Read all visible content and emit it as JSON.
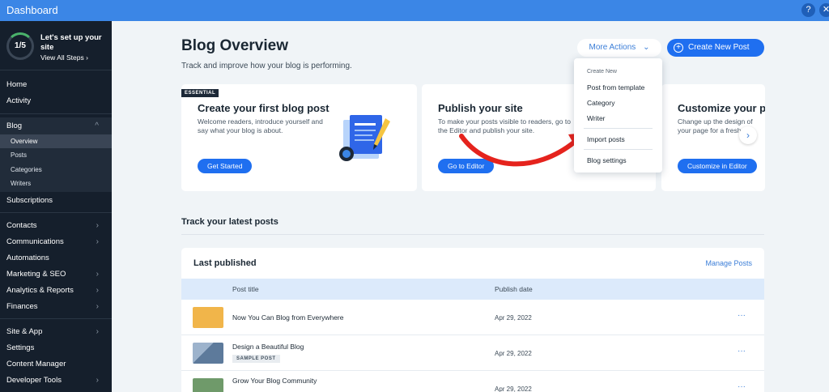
{
  "topbar": {
    "title": "Dashboard",
    "help_glyph": "?",
    "close_glyph": "✕"
  },
  "setup": {
    "progress": "1/5",
    "title": "Let's set up your site",
    "link": "View All Steps ›"
  },
  "sidebar": {
    "items": [
      {
        "label": "Home"
      },
      {
        "label": "Activity"
      },
      {
        "label": "Blog"
      },
      {
        "label": "Subscriptions"
      },
      {
        "label": "Contacts"
      },
      {
        "label": "Communications"
      },
      {
        "label": "Automations"
      },
      {
        "label": "Marketing & SEO"
      },
      {
        "label": "Analytics & Reports"
      },
      {
        "label": "Finances"
      },
      {
        "label": "Site & App"
      },
      {
        "label": "Settings"
      },
      {
        "label": "Content Manager"
      },
      {
        "label": "Developer Tools"
      }
    ],
    "blog_sub": [
      "Overview",
      "Posts",
      "Categories",
      "Writers"
    ],
    "chevron_right": "›",
    "chevron_up": "^"
  },
  "header": {
    "title": "Blog Overview",
    "subtitle": "Track and improve how your blog is performing.",
    "more_actions": "More Actions",
    "more_actions_chevron": "⌄",
    "create_plus": "+",
    "create_new_post": "Create New Post"
  },
  "cards": [
    {
      "badge": "ESSENTIAL",
      "title": "Create your first blog post",
      "desc": "Welcome readers, introduce yourself and say what your blog is about.",
      "button": "Get Started"
    },
    {
      "title": "Publish your site",
      "desc": "To make your posts visible to readers, go to the Editor and publish your site.",
      "button": "Go to Editor"
    },
    {
      "title": "Customize your p",
      "desc": "Change up the design of your page for a fresh loo",
      "button": "Customize in Editor"
    }
  ],
  "carousel_next": "›",
  "latest": {
    "section_title": "Track your latest posts",
    "card_title": "Last published",
    "manage_link": "Manage Posts",
    "columns": [
      "Post title",
      "Publish date"
    ],
    "rows": [
      {
        "title": "Now You Can Blog from Everywhere",
        "tag": "",
        "date": "Apr 29, 2022",
        "thumb_color": "#f1b54a"
      },
      {
        "title": "Design a Beautiful Blog",
        "tag": "SAMPLE POST",
        "date": "Apr 29, 2022",
        "thumb_color": "#7b96b5"
      },
      {
        "title": "Grow Your Blog Community",
        "tag": "",
        "date": "Apr 29, 2022",
        "thumb_color": "#6f9a6a"
      }
    ],
    "row_menu": "···"
  },
  "dropdown": {
    "heading": "Create New",
    "items": [
      "Post from template",
      "Category",
      "Writer",
      "Import posts",
      "Blog settings"
    ]
  },
  "colors": {
    "accent": "#1f6ff0",
    "topbar": "#3b86e6",
    "sidebar": "#151f2c",
    "annotation_arrow": "#e5231d"
  }
}
